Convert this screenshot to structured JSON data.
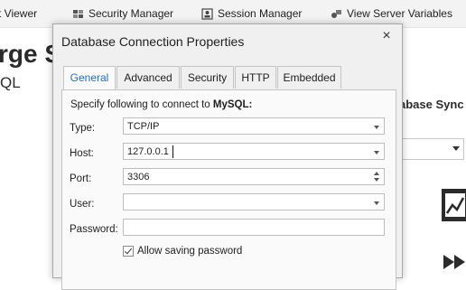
{
  "toolbar": {
    "items": [
      {
        "label": "t Viewer",
        "icon": "viewer-icon"
      },
      {
        "label": "Security Manager",
        "icon": "security-manager-icon"
      },
      {
        "label": "Session Manager",
        "icon": "session-manager-icon"
      },
      {
        "label": "View Server Variables",
        "icon": "server-variables-icon"
      }
    ]
  },
  "background": {
    "title_fragment": "rge S",
    "subtitle_fragment": "QL",
    "right_label_fragment": "abase Sync"
  },
  "dialog": {
    "title": "Database Connection Properties",
    "close_symbol": "×",
    "tabs": [
      {
        "label": "General",
        "active": true
      },
      {
        "label": "Advanced",
        "active": false
      },
      {
        "label": "Security",
        "active": false
      },
      {
        "label": "HTTP",
        "active": false
      },
      {
        "label": "Embedded",
        "active": false
      }
    ],
    "description_prefix": "Specify following to connect to ",
    "description_db": "MySQL:",
    "fields": {
      "type": {
        "label": "Type:",
        "value": "TCP/IP"
      },
      "host": {
        "label": "Host:",
        "value": "127.0.0.1"
      },
      "port": {
        "label": "Port:",
        "value": "3306"
      },
      "user": {
        "label": "User:",
        "value": ""
      },
      "password": {
        "label": "Password:",
        "value": ""
      }
    },
    "allow_saving_password": {
      "label": "Allow saving password",
      "checked": true
    }
  },
  "colors": {
    "active_tab_text": "#2a6cc2",
    "dialog_bg": "#f0f0f0",
    "panel_bg": "#fafafa"
  }
}
